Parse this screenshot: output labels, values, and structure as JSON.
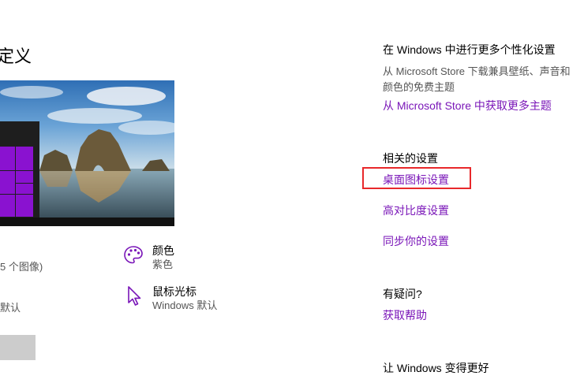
{
  "page": {
    "title_partial": "定义"
  },
  "theme_attributes": {
    "background_partial": "5 个图像)",
    "color": {
      "label": "颜色",
      "value": "紫色",
      "icon": "palette-icon"
    },
    "cursor": {
      "label": "鼠标光标",
      "value": "Windows 默认",
      "icon": "mouse-pointer-icon"
    },
    "sound_partial": "默认"
  },
  "right_panel": {
    "online": {
      "title": "在 Windows 中进行更多个性化设置",
      "desc": "从 Microsoft Store 下载兼具壁纸、声音和颜色的免费主题",
      "link": "从 Microsoft Store 中获取更多主题"
    },
    "related": {
      "title": "相关的设置",
      "links": [
        "桌面图标设置",
        "高对比度设置",
        "同步你的设置"
      ]
    },
    "help": {
      "title": "有疑问?",
      "link": "获取帮助"
    },
    "feedback": {
      "title": "让 Windows 变得更好"
    }
  },
  "colors": {
    "accent": "#7a16b8",
    "tile_purple": "#8a12d0",
    "highlight_red": "#e8282b"
  }
}
